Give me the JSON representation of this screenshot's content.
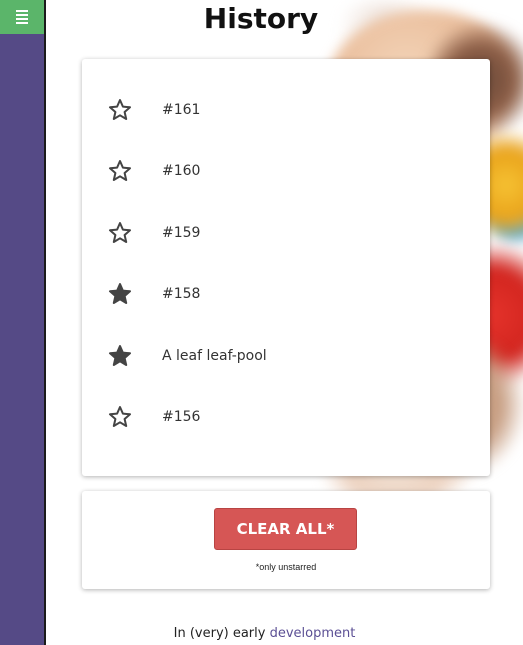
{
  "page": {
    "title": "History"
  },
  "sidebar": {
    "menu_icon": "hamburger-menu-icon",
    "menu_color": "#5bb56a",
    "background": "#554a86"
  },
  "history": {
    "items": [
      {
        "label": "#161",
        "starred": false
      },
      {
        "label": "#160",
        "starred": false
      },
      {
        "label": "#159",
        "starred": false
      },
      {
        "label": "#158",
        "starred": true
      },
      {
        "label": "A leaf leaf-pool",
        "starred": true
      },
      {
        "label": "#156",
        "starred": false
      }
    ]
  },
  "actions": {
    "clear_label": "CLEAR ALL*",
    "clear_note": "*only unstarred",
    "clear_color": "#d65655"
  },
  "footer": {
    "prefix": "In (very) early ",
    "link": "development"
  }
}
